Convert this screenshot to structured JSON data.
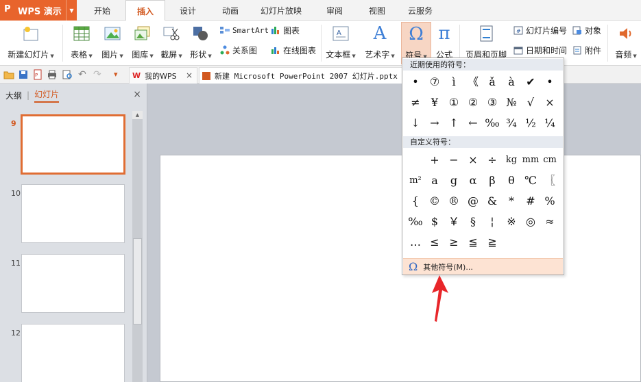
{
  "app": {
    "title": "WPS 演示"
  },
  "menu_tabs": [
    "开始",
    "插入",
    "设计",
    "动画",
    "幻灯片放映",
    "审阅",
    "视图",
    "云服务"
  ],
  "ribbon": {
    "new_slide": "新建幻灯片",
    "table": "表格",
    "picture": "图片",
    "gallery": "图库",
    "screenshot": "截屏",
    "shape": "形状",
    "smartart": "SmartArt",
    "chart": "图表",
    "relation": "关系图",
    "online_chart": "在线图表",
    "textbox": "文本框",
    "wordart": "艺术字",
    "symbol": "符号",
    "formula": "公式",
    "header_footer": "页眉和页脚",
    "slide_number": "幻灯片编号",
    "object": "对象",
    "datetime": "日期和时间",
    "attachment": "附件",
    "audio": "音频"
  },
  "docs": {
    "wps_tab": "我的WPS",
    "file_tab": "新建 Microsoft PowerPoint 2007 幻灯片.pptx"
  },
  "left_panel": {
    "outline": "大纲",
    "slides": "幻灯片",
    "slide_numbers": [
      "9",
      "10",
      "11",
      "12"
    ]
  },
  "symbols": {
    "recent_title": "近期使用的符号：",
    "recent": [
      "•",
      "⑦",
      "ì",
      "《",
      "ǎ",
      "à",
      "✔",
      "•",
      "≠",
      "¥",
      "①",
      "②",
      "③",
      "№",
      "√",
      "×",
      "↓",
      "→",
      "↑",
      "←",
      "‰",
      "¾",
      "½",
      "¼"
    ],
    "custom_title": "自定义符号：",
    "custom": [
      "",
      "+",
      "−",
      "×",
      "÷",
      "kg",
      "mm",
      "cm",
      "m²",
      "a",
      "g",
      "α",
      "β",
      "θ",
      "℃",
      "〖",
      "{",
      "©",
      "®",
      "@",
      "&",
      "*",
      "#",
      "%",
      "‰",
      "$",
      "￥",
      "§",
      "¦",
      "※",
      "◎",
      "≈",
      "…",
      "≤",
      "≥",
      "≦",
      "≧"
    ],
    "more": "其他符号(M)..."
  }
}
